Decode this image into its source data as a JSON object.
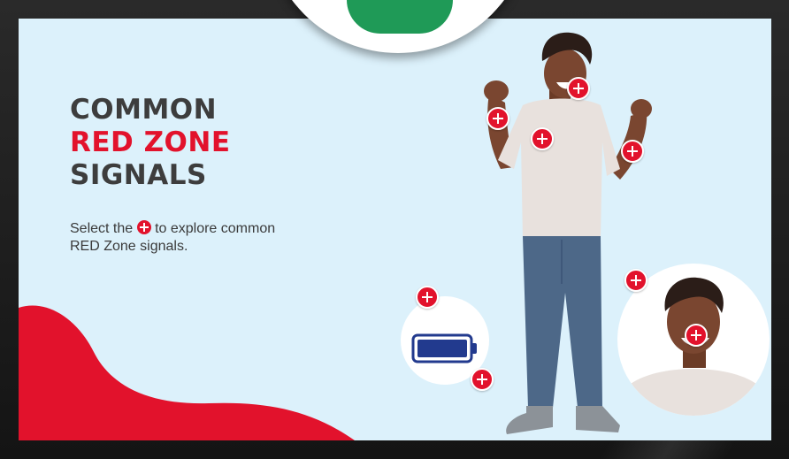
{
  "title": {
    "line1": "COMMON",
    "line2": "RED ZONE",
    "line3": "SIGNALS"
  },
  "instructions": {
    "before_icon": "Select the",
    "after_icon": "to explore common RED Zone signals."
  },
  "icons": {
    "hotspot": "plus-circle-icon",
    "battery": "low-battery-icon"
  },
  "colors": {
    "accent_red": "#e2122c",
    "screen_bg": "#dcf1fb",
    "badge_green": "#1f9a57",
    "battery_blue": "#223a8e",
    "title_text": "#3d3d3d"
  }
}
